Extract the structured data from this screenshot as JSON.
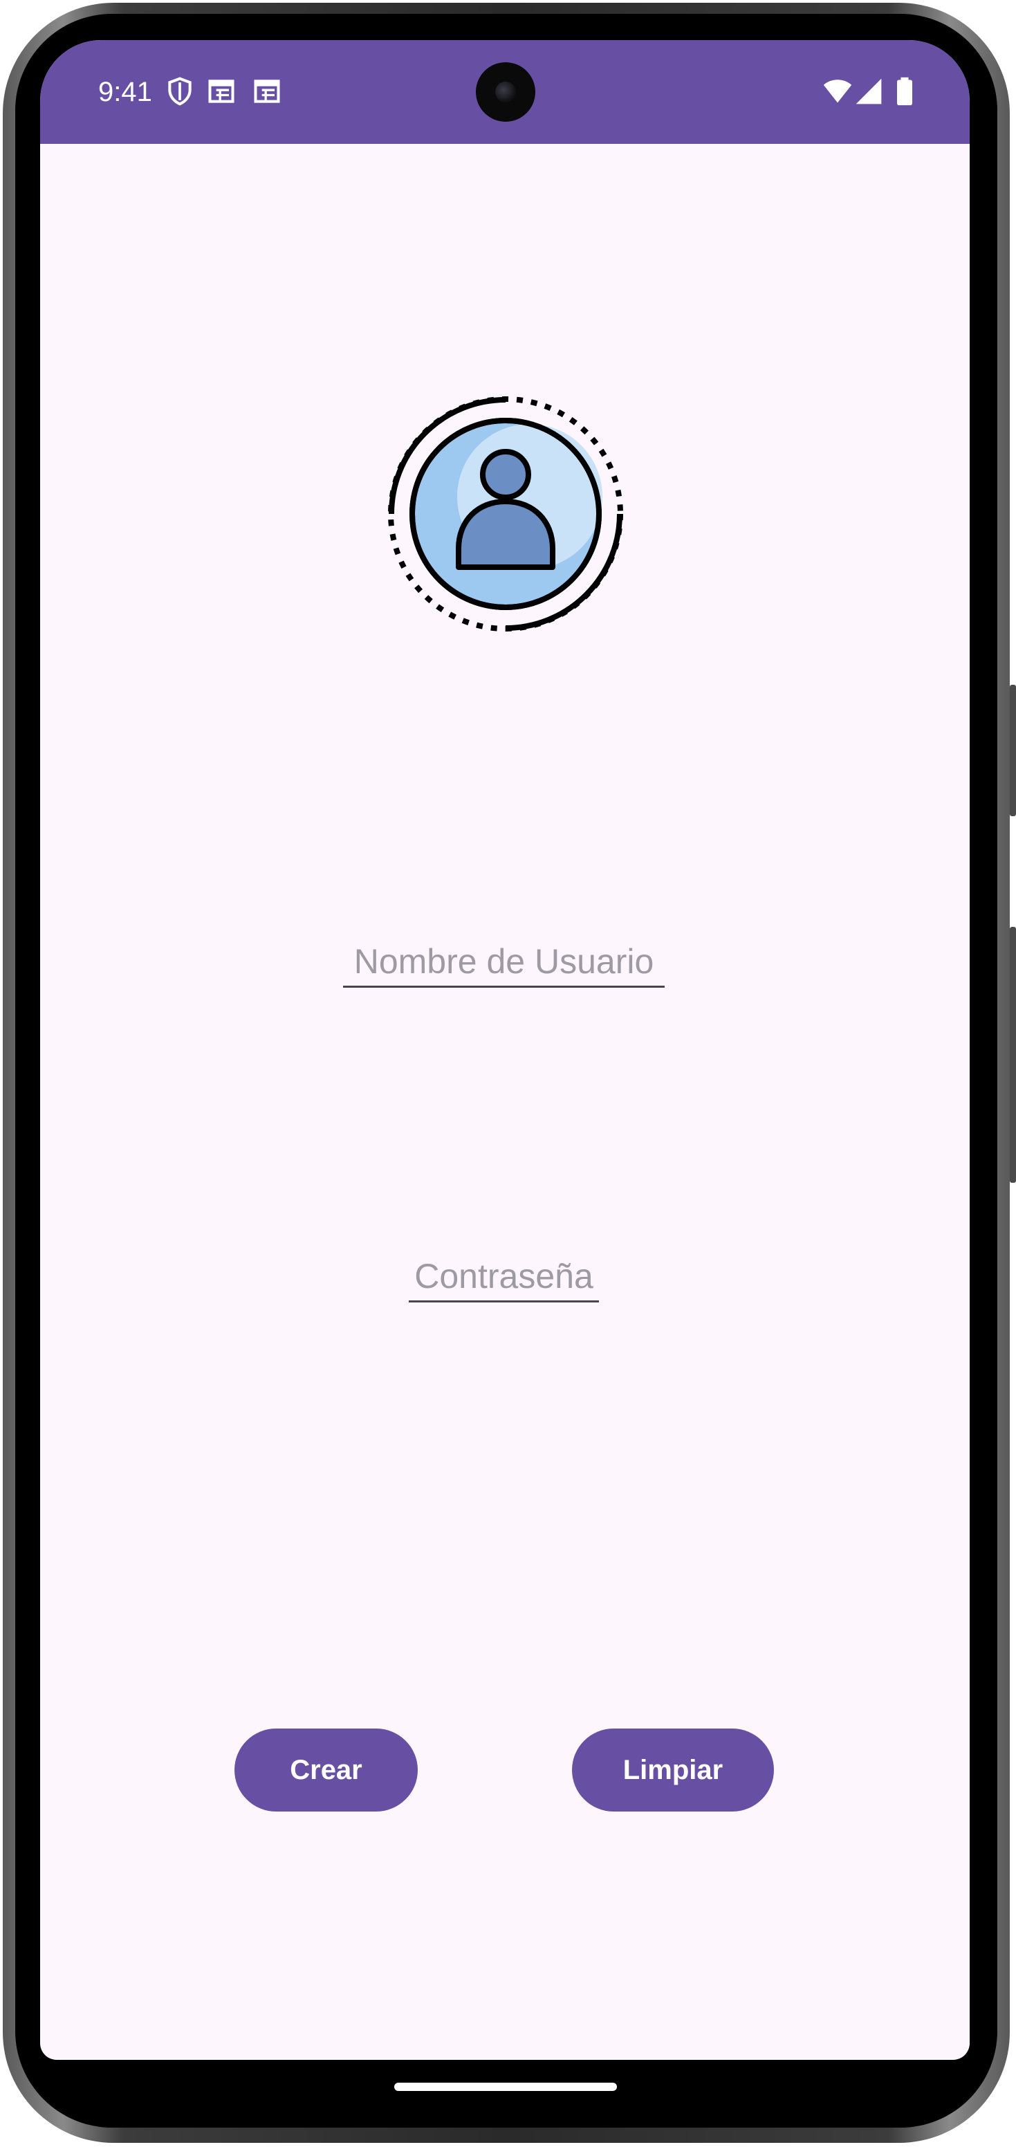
{
  "status_bar": {
    "time": "9:41",
    "left_icons": [
      "shield-icon",
      "calendar-icon",
      "calendar-icon"
    ],
    "right_icons": [
      "wifi-icon",
      "cellular-signal-icon",
      "battery-icon"
    ]
  },
  "form": {
    "username_placeholder": "Nombre de Usuario",
    "password_placeholder": "Contraseña"
  },
  "buttons": {
    "create_label": "Crear",
    "clear_label": "Limpiar"
  },
  "colors": {
    "primary": "#6750a4",
    "background": "#fdf6fc",
    "hint_text": "#9e9aa3",
    "underline": "#49454f",
    "avatar_fill_light": "#c9e2f8",
    "avatar_fill_mid": "#9dc8f0",
    "avatar_person": "#6b8fc4"
  }
}
